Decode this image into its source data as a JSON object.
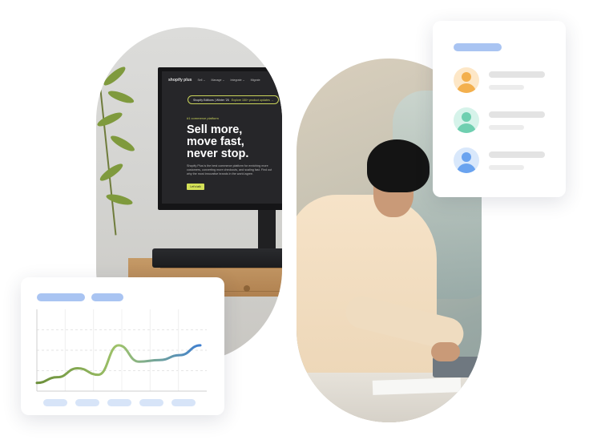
{
  "monitor_site": {
    "logo": "shopify plus",
    "nav": [
      "Sell ⌄",
      "Manage ⌄",
      "Integrate ⌄",
      "Migrate"
    ],
    "banner_primary": "Shopify Editions | Winter '25",
    "banner_secondary": "Explore 150+ product updates →",
    "kicker": "#1 commerce platform",
    "hero_lines": [
      "Sell more,",
      "move fast,",
      "never stop."
    ],
    "body": "Shopify Plus is the best commerce platform for enriching more customers, converting more checkouts, and scaling fast. Find out why the most innovative brands in the world agree.",
    "cta": "Let's talk"
  },
  "users_card": {
    "users": [
      {
        "name": "user-orange",
        "head": "#f3b04e",
        "body": "#f3b04e",
        "ring": "#fde7c7"
      },
      {
        "name": "user-green",
        "head": "#6fcfb0",
        "body": "#6fcfb0",
        "ring": "#d6f3ea"
      },
      {
        "name": "user-blue",
        "head": "#6aa3ef",
        "body": "#6aa3ef",
        "ring": "#d9e8fb"
      }
    ]
  },
  "colors": {
    "placeholder_blue": "#a9c4f2",
    "line_start": "#6b8f3a",
    "line_mid": "#9fc36b",
    "line_end": "#3f7fd0"
  },
  "chart_data": {
    "type": "line",
    "categories": [
      "",
      "",
      "",
      "",
      ""
    ],
    "series": [
      {
        "values": [
          0.1,
          0.17,
          0.28,
          0.2,
          0.56,
          0.36,
          0.38,
          0.44,
          0.56
        ]
      }
    ],
    "ylim": [
      0,
      1
    ],
    "grid": true,
    "title": "",
    "xlabel": "",
    "ylabel": ""
  }
}
